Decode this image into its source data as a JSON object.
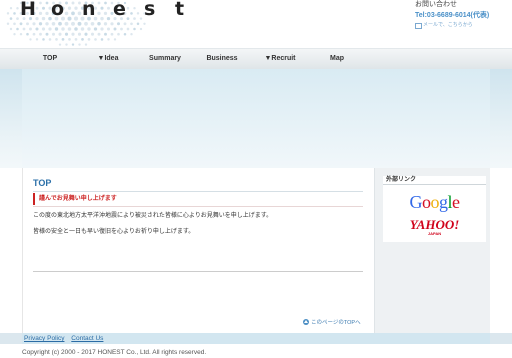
{
  "header": {
    "logo_letters": [
      "H",
      "o",
      "n",
      "e",
      "s",
      "t"
    ],
    "contact_title": "お問い合わせ",
    "contact_tel": "Tel:03-6689-6014(代表)",
    "contact_link": "メールで、こちらから"
  },
  "nav": {
    "items": [
      {
        "label": "TOP"
      },
      {
        "label": "▼Idea"
      },
      {
        "label": "Summary"
      },
      {
        "label": "Business"
      },
      {
        "label": "▼Recruit"
      },
      {
        "label": "Map"
      }
    ]
  },
  "main": {
    "title": "TOP",
    "section_heading": "謹んでお見舞い申し上げます",
    "paragraphs": [
      "この度の東北地方太平洋沖地震により被災された皆様に心よりお見舞いを申し上げます。",
      "皆様の安全と一日も早い復旧を心よりお祈り申し上げます。"
    ],
    "to_top": "このページのTOPへ"
  },
  "side": {
    "title": "外部リンク",
    "google": [
      "G",
      "o",
      "o",
      "g",
      "l",
      "e"
    ],
    "google_colors": [
      "#3369e8",
      "#d50f25",
      "#eeb211",
      "#3369e8",
      "#009925",
      "#d50f25"
    ],
    "yahoo": "YAHOO!",
    "yahoo_sub": "JAPAN"
  },
  "footer": {
    "links": [
      "Privacy Policy",
      "Contact Us"
    ],
    "copyright": "Copyright (c) 2000 - 2017 HONEST Co., Ltd. All rights reserved."
  },
  "colors": {
    "accent": "#2a6fa8",
    "alert": "#cc2222"
  }
}
